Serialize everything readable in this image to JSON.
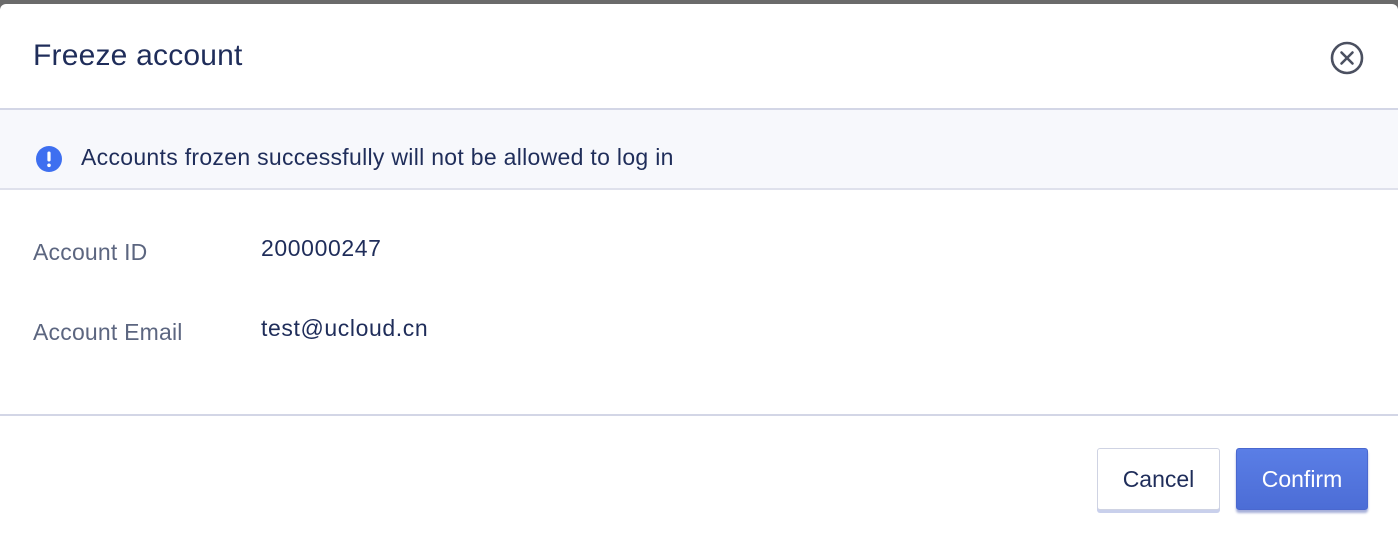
{
  "dialog": {
    "title": "Freeze account",
    "close_icon": "close-circle-icon"
  },
  "notice": {
    "icon": "exclamation-circle-icon",
    "text": "Accounts frozen successfully will not be allowed to log in",
    "icon_color": "#3e6ff0"
  },
  "fields": [
    {
      "label": "Account ID",
      "value": "200000247"
    },
    {
      "label": "Account Email",
      "value": "test@ucloud.cn"
    }
  ],
  "footer": {
    "cancel_label": "Cancel",
    "confirm_label": "Confirm"
  },
  "colors": {
    "primary": "#4f72dc",
    "title_text": "#1f2d5a",
    "label_text": "#5c6680"
  }
}
